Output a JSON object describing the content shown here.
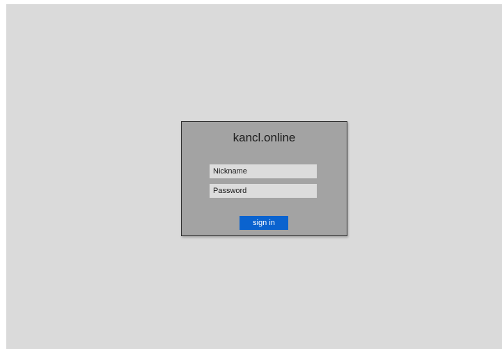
{
  "login": {
    "site_title": "kancl.online",
    "nickname_placeholder": "Nickname",
    "password_placeholder": "Password",
    "sign_in_label": "sign in"
  }
}
